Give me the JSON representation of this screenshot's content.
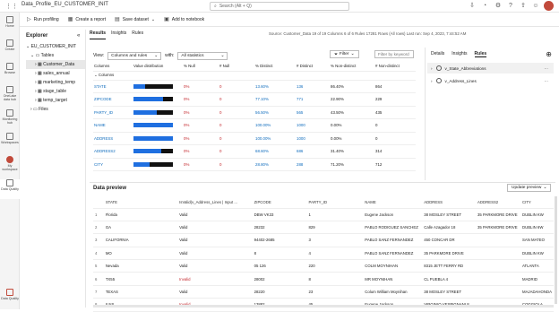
{
  "app": {
    "title": "Data_Profile_EU_CUSTOMER_INIT",
    "search_placeholder": "Search (Alt + Q)"
  },
  "rail": [
    {
      "label": "Home"
    },
    {
      "label": "Create"
    },
    {
      "label": "Browse"
    },
    {
      "label": "OneLake data hub"
    },
    {
      "label": "Monitoring hub"
    },
    {
      "label": "Workspaces"
    },
    {
      "label": "My workspace"
    },
    {
      "label": "Data Quality"
    }
  ],
  "rail_bottom": {
    "label": "Data Quality"
  },
  "toolbar": {
    "run": "Run profiling",
    "report": "Create a report",
    "dataset": "Save dataset",
    "notebook": "Add to notebook"
  },
  "explorer": {
    "title": "Explorer",
    "root": "EU_CUSTOMER_INIT",
    "tables": "Tables",
    "items": [
      "Customer_Data",
      "sales_annual",
      "marketing_temp",
      "stage_table",
      "temp_target"
    ],
    "files": "Files"
  },
  "tabs": [
    "Results",
    "Insights",
    "Rules"
  ],
  "status": "Source: Customer_Data   19 of 19 Columns   6 of 6 Rules   17281 Rows (All rows)   Last run: Sep 4, 2023, 7:44:52 AM",
  "view": {
    "label": "View:",
    "value": "Columns and rules",
    "with": "with:",
    "with_value": "All statistics",
    "filter": "Filter",
    "kw_placeholder": "Filter by keyword"
  },
  "col_headers": [
    "Columns",
    "Value distribution",
    "% Null",
    "# Null",
    "% Distinct",
    "# Distinct",
    "% Non-distinct",
    "# Non-distinct"
  ],
  "group_label": "Columns",
  "columns": [
    {
      "name": "STATE",
      "null_pct": "0%",
      "null_n": "0",
      "dist_pct": "13.60%",
      "dist_n": "136",
      "nd_pct": "86.40%",
      "nd_n": "864",
      "dark": 0.7
    },
    {
      "name": "ZIPCODE",
      "null_pct": "0%",
      "null_n": "0",
      "dist_pct": "77.10%",
      "dist_n": "771",
      "nd_pct": "22.90%",
      "nd_n": "229",
      "dark": 0.25
    },
    {
      "name": "PARTY_ID",
      "null_pct": "0%",
      "null_n": "0",
      "dist_pct": "56.50%",
      "dist_n": "565",
      "nd_pct": "43.50%",
      "nd_n": "435",
      "dark": 0.4
    },
    {
      "name": "NAME",
      "null_pct": "0%",
      "null_n": "0",
      "dist_pct": "100.00%",
      "dist_n": "1000",
      "nd_pct": "0.00%",
      "nd_n": "0",
      "dark": 0.0
    },
    {
      "name": "ADDRESS",
      "null_pct": "0%",
      "null_n": "0",
      "dist_pct": "100.00%",
      "dist_n": "1000",
      "nd_pct": "0.00%",
      "nd_n": "0",
      "dark": 0.0
    },
    {
      "name": "ADDRESS2",
      "null_pct": "0%",
      "null_n": "0",
      "dist_pct": "68.60%",
      "dist_n": "686",
      "nd_pct": "31.40%",
      "nd_n": "314",
      "dark": 0.3
    },
    {
      "name": "CITY",
      "null_pct": "0%",
      "null_n": "0",
      "dist_pct": "28.80%",
      "dist_n": "288",
      "nd_pct": "71.20%",
      "nd_n": "712",
      "dark": 0.6
    }
  ],
  "right_tabs": [
    "Details",
    "Insights",
    "Rules"
  ],
  "rules": [
    "v_State_Abbreviations",
    "v_Address_Lines"
  ],
  "preview": {
    "title": "Data preview",
    "update": "Update preview",
    "headers": [
      "STATE",
      "IsValid(v_Address_Lines | Input ...",
      "ZIPCODE",
      "PARTY_ID",
      "NAME",
      "ADDRESS",
      "ADDRESS2",
      "CITY"
    ],
    "rows": [
      [
        "Florida",
        "Valid",
        "DBW VK33",
        "1",
        "Eugene Jackson",
        "38 MOSLEY STREET",
        "35 PARKMORE DRIVE",
        "DUBLIN KW"
      ],
      [
        "GA",
        "Valid",
        "28232",
        "829",
        "PABLO RODIGUEZ SANCHEZ",
        "Calle Azagador 18",
        "35 PARKMORE DRIVE",
        "DUBLIN 6W"
      ],
      [
        "CALIFORNIA",
        "Valid",
        "94402-2685",
        "3",
        "PABLO SANZ FERNANDEZ",
        "450 CONCAR DR",
        "",
        "SAN MATEO"
      ],
      [
        "MO",
        "Valid",
        "8",
        "4",
        "PABLO SANZ FERNANDEZ",
        "35 PARKMORE DRIVE",
        "",
        "DUBLIN KW"
      ],
      [
        "Nevada",
        "Valid",
        "05 126",
        "220",
        "COLM MOYNIHAN",
        "8315 JETT FERRY RD",
        "",
        "ATLANTA"
      ],
      [
        "TX55",
        "Invalid",
        "28002",
        "8",
        "MR MOYNIHAN",
        "CL PUEBLA 4",
        "",
        "MADRID"
      ],
      [
        "TEXAS",
        "Valid",
        "28220",
        "23",
        "Colum William Moynihan",
        "38 MOSLEY STREET",
        "",
        "MAJADAHONDA"
      ],
      [
        "ILNS",
        "Invalid",
        "13882",
        "45",
        "Eugene Jackson",
        "VIRGINIO VESPIGNANI 8",
        "",
        "COGGIOLA"
      ]
    ]
  }
}
